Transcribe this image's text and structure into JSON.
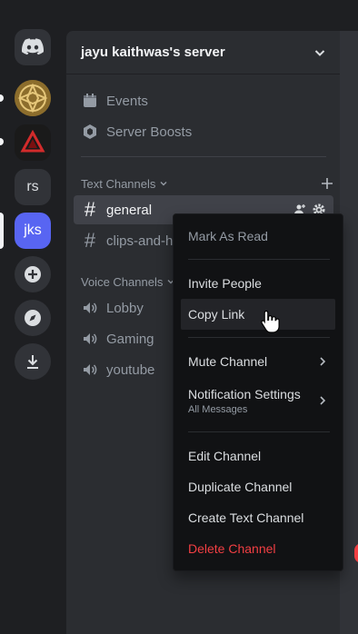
{
  "server": {
    "name": "jayu kaithwas's server"
  },
  "rail": {
    "items": [
      "rs",
      "jks"
    ]
  },
  "sidebar": {
    "top_items": [
      {
        "label": "Events",
        "icon": "calendar-icon"
      },
      {
        "label": "Server Boosts",
        "icon": "boost-icon"
      }
    ],
    "text_category": "Text Channels",
    "text_channels": [
      "general",
      "clips-and-highlights"
    ],
    "voice_category": "Voice Channels",
    "voice_channels": [
      "Lobby",
      "Gaming",
      "youtube"
    ]
  },
  "context_menu": {
    "mark_as_read": "Mark As Read",
    "invite_people": "Invite People",
    "copy_link": "Copy Link",
    "mute_channel": "Mute Channel",
    "notification_settings": "Notification Settings",
    "notification_value": "All Messages",
    "edit_channel": "Edit Channel",
    "duplicate_channel": "Duplicate Channel",
    "create_text_channel": "Create Text Channel",
    "delete_channel": "Delete Channel"
  },
  "colors": {
    "blurple": "#5865f2",
    "danger": "#f23f43",
    "menu_bg": "#111214"
  }
}
